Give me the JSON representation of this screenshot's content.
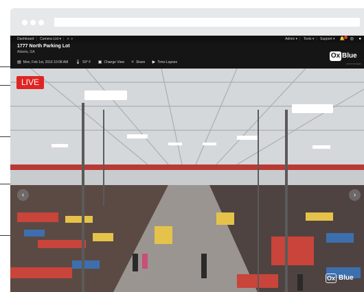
{
  "nav": {
    "left": [
      "Dashboard",
      "Camera List ▾",
      "«",
      "»"
    ],
    "right": [
      "Admin ▾",
      "Tools ▾",
      "Support ▾"
    ]
  },
  "camera": {
    "title": "1777 North Parking Lot",
    "location": "Atlanta, GA",
    "datetime": "Mon, Feb 1st, 2016 10:08 AM",
    "temperature": "59° F",
    "change_view": "Change View",
    "share": "Share",
    "time_lapses": "Time-Lapses"
  },
  "brand": {
    "logo_mark": "Ox",
    "logo_word": "Blue",
    "logo_sub": "part of Hexagon"
  },
  "overlay": {
    "live": "LIVE",
    "watermark_mark": "Ox",
    "watermark_word": "Blue"
  },
  "icons": {
    "calendar": "calendar-icon",
    "thermometer": "thermometer-icon",
    "change_view": "window-icon",
    "share": "share-icon",
    "time_lapse": "play-circle-icon",
    "prev": "chevron-left-icon",
    "next": "chevron-right-icon"
  },
  "colors": {
    "live": "#e02424",
    "badge": "#e23b3b",
    "bar": "#151515"
  }
}
